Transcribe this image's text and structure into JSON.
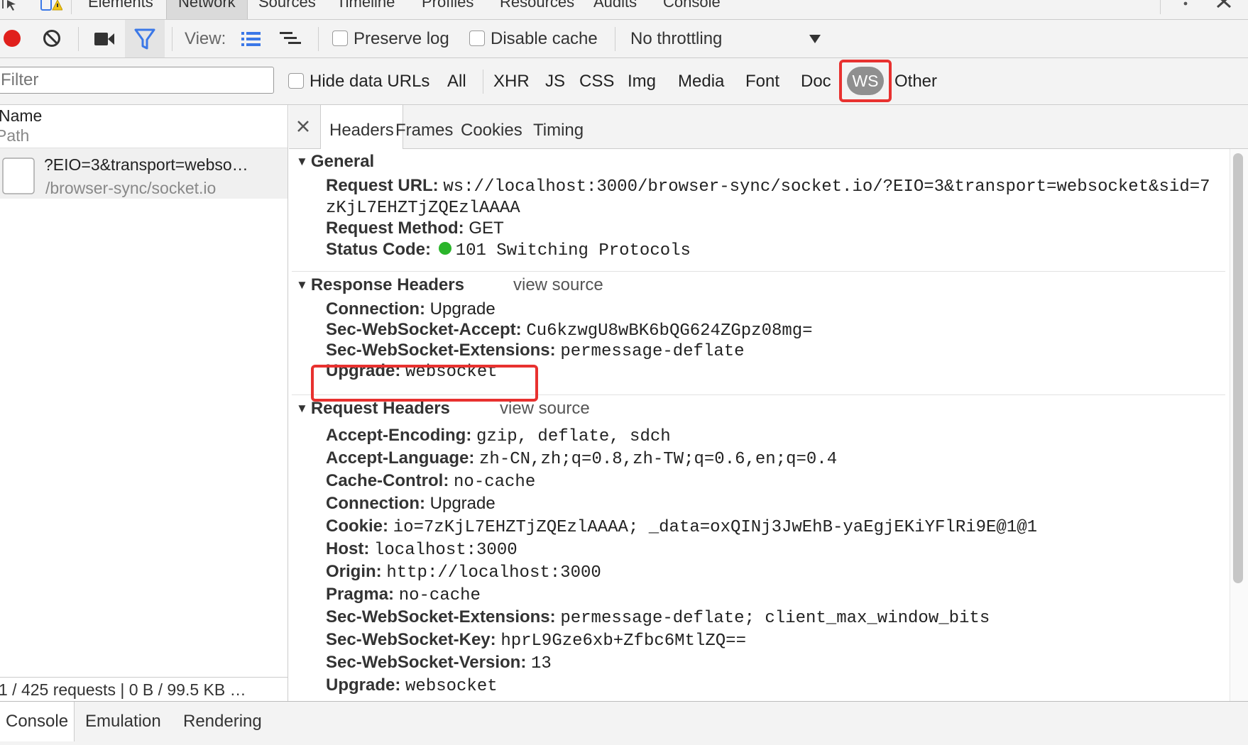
{
  "top_tabs": [
    "Elements",
    "Network",
    "Sources",
    "Timeline",
    "Profiles",
    "Resources",
    "Audits",
    "Console"
  ],
  "toolbar": {
    "view_label": "View:",
    "preserve_log": "Preserve log",
    "disable_cache": "Disable cache",
    "throttling": "No throttling"
  },
  "filter": {
    "placeholder": "Filter",
    "hide_data_urls": "Hide data URLs",
    "types": [
      "All",
      "XHR",
      "JS",
      "CSS",
      "Img",
      "Media",
      "Font",
      "Doc",
      "WS",
      "Other"
    ],
    "active_type": "WS"
  },
  "request_list": {
    "col_name": "Name",
    "col_path": "Path",
    "items": [
      {
        "name": "?EIO=3&transport=webso…",
        "path": "/browser-sync/socket.io"
      }
    ],
    "status": "1 / 425 requests | 0 B / 99.5 KB …"
  },
  "detail_tabs": [
    "Headers",
    "Frames",
    "Cookies",
    "Timing"
  ],
  "general": {
    "title": "General",
    "request_url_key": "Request URL:",
    "request_url_1": "ws://localhost:3000/browser-sync/socket.io/?EIO=3&transport=websocket&sid=7",
    "request_url_2": "zKjL7EHZTjZQEzlAAAA",
    "method_key": "Request Method:",
    "method_val": "GET",
    "status_key": "Status Code:",
    "status_val": "101 Switching Protocols",
    "status_color": "#2bb52b"
  },
  "response_headers": {
    "title": "Response Headers",
    "view_source": "view source",
    "rows": [
      {
        "k": "Connection:",
        "v": "Upgrade"
      },
      {
        "k": "Sec-WebSocket-Accept:",
        "v": "Cu6kzwgU8wBK6bQG624ZGpz08mg="
      },
      {
        "k": "Sec-WebSocket-Extensions:",
        "v": "permessage-deflate"
      },
      {
        "k": "Upgrade:",
        "v": "websocket"
      }
    ]
  },
  "request_headers": {
    "title": "Request Headers",
    "view_source": "view source",
    "rows": [
      {
        "k": "Accept-Encoding:",
        "v": "gzip, deflate, sdch"
      },
      {
        "k": "Accept-Language:",
        "v": "zh-CN,zh;q=0.8,zh-TW;q=0.6,en;q=0.4"
      },
      {
        "k": "Cache-Control:",
        "v": "no-cache"
      },
      {
        "k": "Connection:",
        "v": "Upgrade"
      },
      {
        "k": "Cookie:",
        "v": "io=7zKjL7EHZTjZQEzlAAAA; _data=oxQINj3JwEhB-yaEgjEKiYFlRi9E@1@1"
      },
      {
        "k": "Host:",
        "v": "localhost:3000"
      },
      {
        "k": "Origin:",
        "v": "http://localhost:3000"
      },
      {
        "k": "Pragma:",
        "v": "no-cache"
      },
      {
        "k": "Sec-WebSocket-Extensions:",
        "v": "permessage-deflate; client_max_window_bits"
      },
      {
        "k": "Sec-WebSocket-Key:",
        "v": "hprL9Gze6xb+Zfbc6MtlZQ=="
      },
      {
        "k": "Sec-WebSocket-Version:",
        "v": "13"
      },
      {
        "k": "Upgrade:",
        "v": "websocket"
      }
    ]
  },
  "drawer_tabs": [
    "Console",
    "Emulation",
    "Rendering"
  ],
  "colors": {
    "highlight": "#e8312f",
    "record": "#e0201c",
    "accent": "#3b78e7"
  }
}
